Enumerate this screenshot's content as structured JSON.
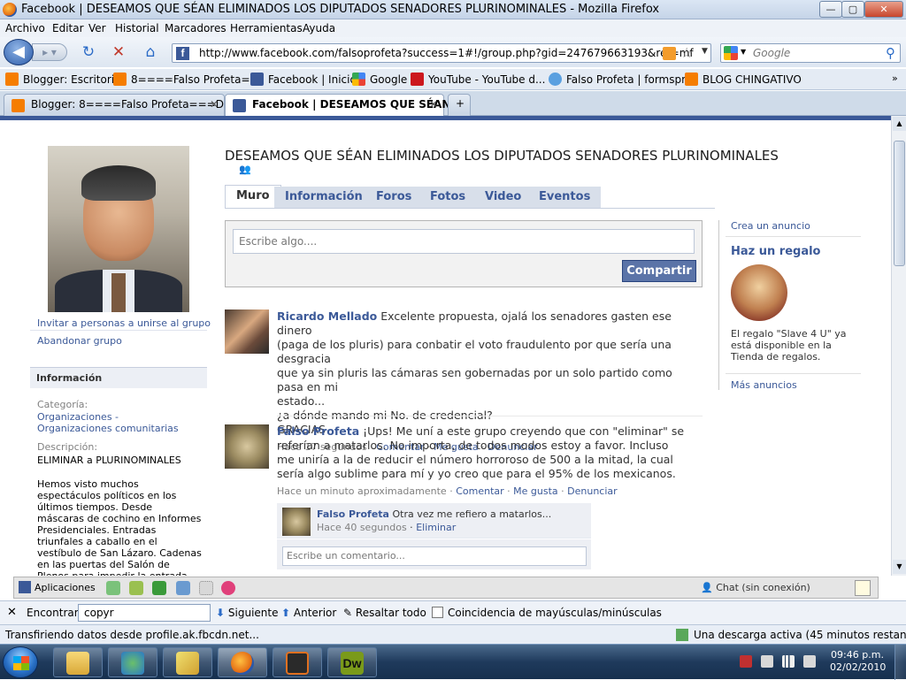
{
  "window": {
    "title": "Facebook | DESEAMOS QUE SÉAN ELIMINADOS LOS DIPUTADOS SENADORES PLURINOMINALES - Mozilla Firefox",
    "min": "—",
    "max": "▢",
    "close": "✕"
  },
  "menu": [
    "Archivo",
    "Editar",
    "Ver",
    "Historial",
    "Marcadores",
    "Herramientas",
    "Ayuda"
  ],
  "nav": {
    "url": "http://www.facebook.com/falsoprofeta?success=1#!/group.php?gid=247679663193&ref=mf",
    "search_placeholder": "Google"
  },
  "bookmarks": [
    {
      "label": "Blogger: Escritorio",
      "icon": "blogger-icon"
    },
    {
      "label": "8====Falso Profeta=...",
      "icon": "blogger-icon"
    },
    {
      "label": "Facebook | Inicio",
      "icon": "facebook-icon"
    },
    {
      "label": "Google",
      "icon": "google-icon"
    },
    {
      "label": "YouTube - YouTube d...",
      "icon": "youtube-icon"
    },
    {
      "label": "Falso Profeta | formspr...",
      "icon": "formspring-icon"
    },
    {
      "label": "BLOG CHINGATIVO",
      "icon": "blogger-icon"
    }
  ],
  "tabs": [
    {
      "label": "Blogger: 8====Falso Profeta===D ...",
      "active": false
    },
    {
      "label": "Facebook | DESEAMOS QUE SÉAN...",
      "active": true
    }
  ],
  "group": {
    "title": "DESEAMOS QUE SÉAN ELIMINADOS LOS DIPUTADOS SENADORES PLURINOMINALES",
    "tabs": [
      "Muro",
      "Información",
      "Foros",
      "Fotos",
      "Video",
      "Eventos"
    ],
    "composer_placeholder": "Escribe algo....",
    "share": "Compartir"
  },
  "sidebar": {
    "invite": "Invitar a personas a unirse al grupo",
    "leave": "Abandonar grupo",
    "info_header": "Información",
    "category_label": "Categoría:",
    "category_value": "Organizaciones - Organizaciones comunitarias",
    "description_label": "Descripción:",
    "description_value": "ELIMINAR a PLURINOMINALES",
    "description_text": "Hemos visto muchos espectáculos políticos en los últimos tiempos. Desde máscaras de cochino en Informes Presidenciales. Entradas triunfales a caballo en el vestíbulo de San Lázaro. Cadenas en las puertas del Salón de Plenos para impedir la entrada de un Presidente entrante, o diputados destrozando curules para hacer"
  },
  "feed": [
    {
      "author": "Ricardo Mellado",
      "lines": [
        "Excelente propuesta, ojalá los senadores gasten ese dinero",
        "(paga de los pluris) para conbatir el voto fraudulento por que sería una desgracia",
        "que ya sin pluris las cámaras sen gobernadas por un solo partido como pasa en mi",
        "estado...",
        "¿a dónde mando mi No. de credencial?",
        "GRACIAS"
      ],
      "time": "Hace 17 segundos",
      "actions": [
        "Comentar",
        "Me gusta",
        "Denunciar"
      ]
    },
    {
      "author": "Falso Profeta",
      "lines": [
        "¡Ups! Me uní a este grupo creyendo que con \"eliminar\" se",
        "referían a matarlos. No importa, de todos modos estoy a favor. Incluso",
        "me uniría a la de reducir el número horroroso de 500 a la mitad, la cual",
        "sería algo sublime para mí y yo creo que para el 95% de los mexicanos."
      ],
      "time": "Hace un minuto aproximadamente",
      "actions": [
        "Comentar",
        "Me gusta",
        "Denunciar"
      ],
      "comment": {
        "author": "Falso Profeta",
        "text": "Otra vez me refiero a matarlos...",
        "time": "Hace 40 segundos",
        "action": "Eliminar"
      },
      "comment_placeholder": "Escribe un comentario..."
    }
  ],
  "ads": {
    "create": "Crea un anuncio",
    "title": "Haz un regalo",
    "text": "El regalo \"Slave 4 U\" ya está disponible en la Tienda de regalos.",
    "more": "Más anuncios"
  },
  "fbbar": {
    "apps": "Aplicaciones",
    "chat": "Chat (sin conexión)"
  },
  "findbar": {
    "label": "Encontrar:",
    "value": "copyr",
    "next": "Siguiente",
    "prev": "Anterior",
    "highlight": "Resaltar todo",
    "matchcase": "Coincidencia de mayúsculas/minúsculas"
  },
  "status": {
    "text": "Transfiriendo datos desde profile.ak.fbcdn.net...",
    "download": "Una descarga activa (45 minutos restante(s))"
  },
  "taskbar": {
    "time": "09:46 p.m.",
    "date": "02/02/2010"
  }
}
